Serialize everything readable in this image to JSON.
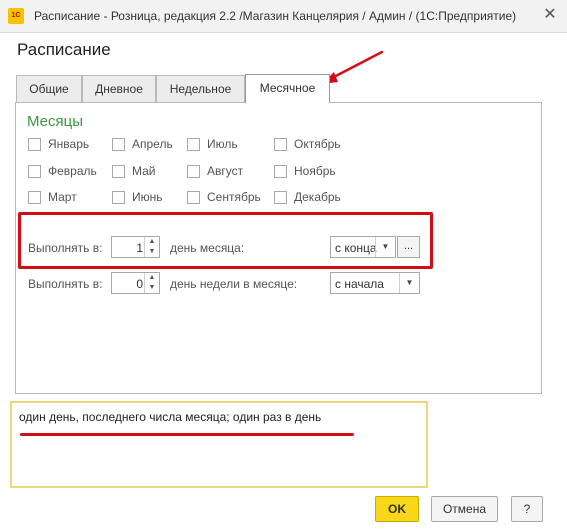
{
  "window": {
    "title": "Расписание - Розница, редакция 2.2 /Магазин Канцелярия / Админ /  (1С:Предприятие)",
    "app_icon_text": "1С",
    "close_glyph": "✕"
  },
  "form": {
    "title": "Расписание"
  },
  "tabs": [
    {
      "label": "Общие"
    },
    {
      "label": "Дневное"
    },
    {
      "label": "Недельное"
    },
    {
      "label": "Месячное",
      "active": true
    }
  ],
  "months": {
    "heading": "Месяцы",
    "items": [
      {
        "label": "Январь",
        "checked": false
      },
      {
        "label": "Апрель",
        "checked": false
      },
      {
        "label": "Июль",
        "checked": false
      },
      {
        "label": "Октябрь",
        "checked": false
      },
      {
        "label": "Февраль",
        "checked": false
      },
      {
        "label": "Май",
        "checked": false
      },
      {
        "label": "Август",
        "checked": false
      },
      {
        "label": "Ноябрь",
        "checked": false
      },
      {
        "label": "Март",
        "checked": false
      },
      {
        "label": "Июнь",
        "checked": false
      },
      {
        "label": "Сентябрь",
        "checked": false
      },
      {
        "label": "Декабрь",
        "checked": false
      }
    ]
  },
  "row_day": {
    "label": "Выполнять в:",
    "value": "1",
    "suffix": "день месяца:",
    "select_value": "с конца",
    "more_label": "..."
  },
  "row_weekday": {
    "label": "Выполнять в:",
    "value": "0",
    "suffix": "день недели в месяце:",
    "select_value": "с начала"
  },
  "summary": {
    "text": "один день, последнего числа месяца; один раз в день"
  },
  "buttons": {
    "ok": "OK",
    "cancel": "Отмена",
    "help": "?"
  },
  "glyphs": {
    "spin_up": "▲",
    "spin_down": "▼",
    "dropdown": "▼"
  },
  "colors": {
    "annotation_red": "#d50b16",
    "heading_green": "#3a9a3a",
    "ok_yellow": "#f8d61a",
    "summary_border": "#f0d67a"
  }
}
